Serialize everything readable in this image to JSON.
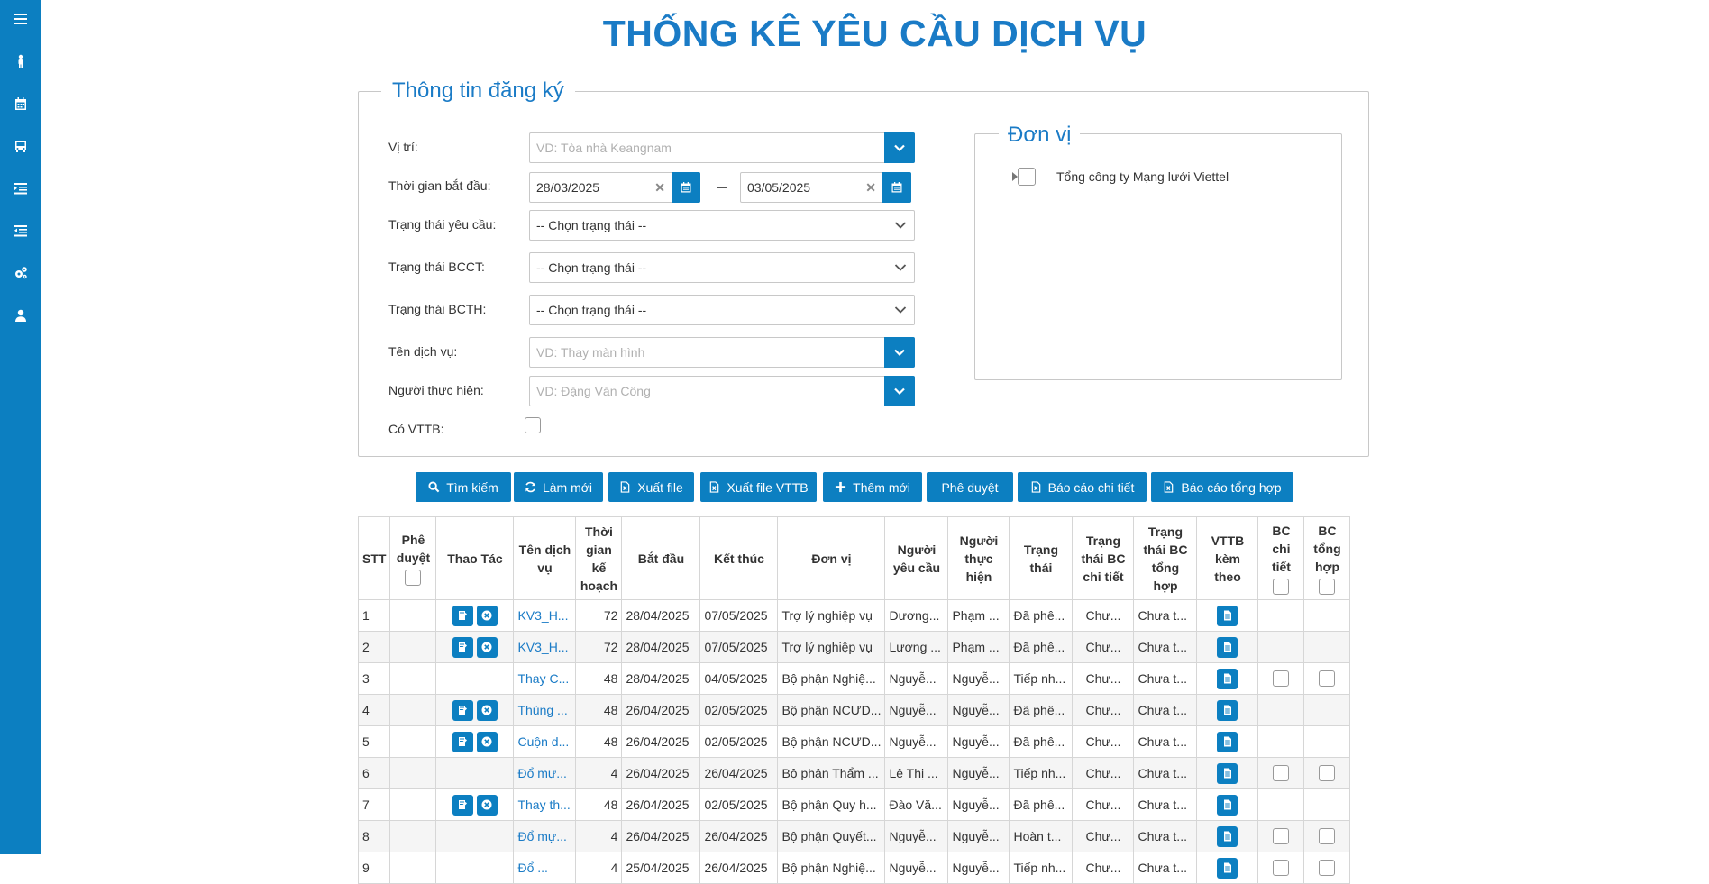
{
  "title": "THỐNG KÊ YÊU CẦU DỊCH VỤ",
  "sidebar": {
    "icons": [
      "menu-icon",
      "person-icon",
      "calendar-icon",
      "bus-icon",
      "list-indent-icon",
      "list-outdent-icon",
      "gears-icon",
      "user-icon"
    ]
  },
  "form": {
    "legend": "Thông tin đăng ký",
    "location": {
      "label": "Vị trí:",
      "placeholder": "VD: Tòa nhà Keangnam"
    },
    "start_time": {
      "label": "Thời gian bắt đầu:",
      "from": "28/03/2025",
      "to": "03/05/2025",
      "separator": "–"
    },
    "request_status": {
      "label": "Trạng thái yêu cầu:",
      "value": "-- Chọn trạng thái --"
    },
    "bcct_status": {
      "label": "Trạng thái BCCT:",
      "value": "-- Chọn trạng thái --"
    },
    "bcth_status": {
      "label": "Trạng thái BCTH:",
      "value": "-- Chọn trạng thái --"
    },
    "service_name": {
      "label": "Tên dịch vụ:",
      "placeholder": "VD: Thay màn hình"
    },
    "performer": {
      "label": "Người thực hiện:",
      "placeholder": "VD: Đặng Văn Công"
    },
    "has_vttb": {
      "label": "Có VTTB:"
    }
  },
  "unit": {
    "legend": "Đơn vị",
    "tree": [
      {
        "label": "Tổng công ty Mạng lưới Viettel"
      }
    ]
  },
  "buttons": {
    "search": "Tìm kiếm",
    "refresh": "Làm mới",
    "export": "Xuất file",
    "export_vttb": "Xuất file VTTB",
    "add": "Thêm mới",
    "approve": "Phê duyệt",
    "detail_report": "Báo cáo chi tiết",
    "summary_report": "Báo cáo tổng hợp"
  },
  "table": {
    "headers": [
      "STT",
      "Phê duyệt",
      "Thao Tác",
      "Tên dịch vụ",
      "Thời gian kế hoạch",
      "Bắt đầu",
      "Kết thúc",
      "Đơn vị",
      "Người yêu cầu",
      "Người thực hiện",
      "Trạng thái",
      "Trạng thái BC chi tiết",
      "Trạng thái BC tổng hợp",
      "VTTB kèm theo",
      "BC chi tiết",
      "BC tổng hợp"
    ],
    "rows": [
      {
        "stt": "1",
        "actions": true,
        "name": "KV3_H...",
        "plan": "72",
        "start": "28/04/2025",
        "end": "07/05/2025",
        "unit": "Trợ lý nghiệp vụ",
        "requester": "Dương...",
        "performer": "Phạm ...",
        "status": "Đã phê...",
        "bcct": "Chư...",
        "bcth": "Chưa t...",
        "checks": false
      },
      {
        "stt": "2",
        "actions": true,
        "name": "KV3_H...",
        "plan": "72",
        "start": "28/04/2025",
        "end": "07/05/2025",
        "unit": "Trợ lý nghiệp vụ",
        "requester": "Lương ...",
        "performer": "Phạm ...",
        "status": "Đã phê...",
        "bcct": "Chư...",
        "bcth": "Chưa t...",
        "checks": false
      },
      {
        "stt": "3",
        "actions": false,
        "name": "Thay C...",
        "plan": "48",
        "start": "28/04/2025",
        "end": "04/05/2025",
        "unit": "Bộ phận Nghiệ...",
        "requester": "Nguyễ...",
        "performer": "Nguyễ...",
        "status": "Tiếp nh...",
        "bcct": "Chư...",
        "bcth": "Chưa t...",
        "checks": true
      },
      {
        "stt": "4",
        "actions": true,
        "name": "Thùng ...",
        "plan": "48",
        "start": "26/04/2025",
        "end": "02/05/2025",
        "unit": "Bộ phận NCƯD...",
        "requester": "Nguyễ...",
        "performer": "Nguyễ...",
        "status": "Đã phê...",
        "bcct": "Chư...",
        "bcth": "Chưa t...",
        "checks": false
      },
      {
        "stt": "5",
        "actions": true,
        "name": "Cuộn d...",
        "plan": "48",
        "start": "26/04/2025",
        "end": "02/05/2025",
        "unit": "Bộ phận NCƯD...",
        "requester": "Nguyễ...",
        "performer": "Nguyễ...",
        "status": "Đã phê...",
        "bcct": "Chư...",
        "bcth": "Chưa t...",
        "checks": false
      },
      {
        "stt": "6",
        "actions": false,
        "name": "Đổ mự...",
        "plan": "4",
        "start": "26/04/2025",
        "end": "26/04/2025",
        "unit": "Bộ phận Thẩm ...",
        "requester": "Lê Thị ...",
        "performer": "Nguyễ...",
        "status": "Tiếp nh...",
        "bcct": "Chư...",
        "bcth": "Chưa t...",
        "checks": true
      },
      {
        "stt": "7",
        "actions": true,
        "name": "Thay th...",
        "plan": "48",
        "start": "26/04/2025",
        "end": "02/05/2025",
        "unit": "Bộ phận Quy h...",
        "requester": "Đào Vă...",
        "performer": "Nguyễ...",
        "status": "Đã phê...",
        "bcct": "Chư...",
        "bcth": "Chưa t...",
        "checks": false
      },
      {
        "stt": "8",
        "actions": false,
        "name": "Đổ mự...",
        "plan": "4",
        "start": "26/04/2025",
        "end": "26/04/2025",
        "unit": "Bộ phận Quyết...",
        "requester": "Nguyễ...",
        "performer": "Nguyễ...",
        "status": "Hoàn t...",
        "bcct": "Chư...",
        "bcth": "Chưa t...",
        "checks": true
      },
      {
        "stt": "9",
        "actions": false,
        "name": "Đổ ...",
        "plan": "4",
        "start": "25/04/2025",
        "end": "26/04/2025",
        "unit": "Bộ phận Nghiệ...",
        "requester": "Nguyễ...",
        "performer": "Nguyễ...",
        "status": "Tiếp nh...",
        "bcct": "Chư...",
        "bcth": "Chưa t...",
        "checks": true
      }
    ]
  },
  "colors": {
    "primary": "#0c7fc1",
    "title": "#1a7bc6",
    "link": "#1a7bc6"
  }
}
